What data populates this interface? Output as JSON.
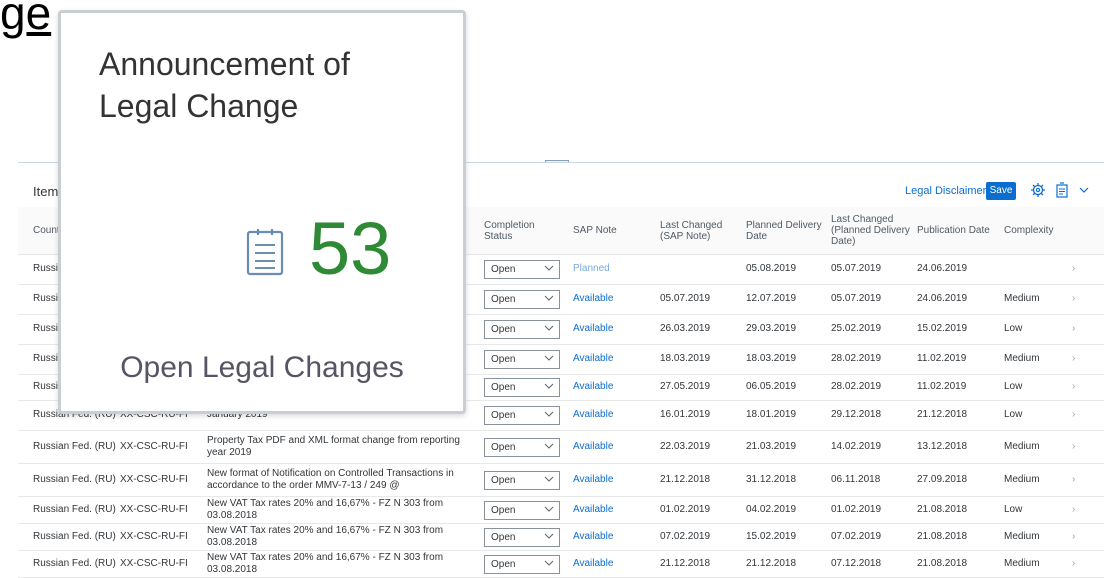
{
  "slide": {
    "heading_fragment": "ge"
  },
  "table": {
    "title": "Item",
    "disclaimer": "Legal Disclaimer",
    "save_label": "Save",
    "columns": {
      "country": "Count",
      "completion_status": "Completion Status",
      "sap_note": "SAP Note",
      "last_changed_sap": "Last Changed (SAP Note)",
      "planned_delivery": "Planned Delivery Date",
      "last_changed_planned": "Last Changed (Planned Delivery Date)",
      "publication_date": "Publication Date",
      "complexity": "Complexity"
    },
    "rows": [
      {
        "country": "Russi",
        "component": "",
        "description": "",
        "status": "Open",
        "sap_note": "Planned",
        "last_changed_sap": "",
        "planned_delivery": "05.08.2019",
        "last_changed_planned": "05.07.2019",
        "publication": "24.06.2019",
        "complexity": ""
      },
      {
        "country": "Russi",
        "component": "",
        "description": "",
        "status": "Open",
        "sap_note": "Available",
        "last_changed_sap": "05.07.2019",
        "planned_delivery": "12.07.2019",
        "last_changed_planned": "05.07.2019",
        "publication": "24.06.2019",
        "complexity": "Medium"
      },
      {
        "country": "Russi",
        "component": "",
        "description": "",
        "status": "Open",
        "sap_note": "Available",
        "last_changed_sap": "26.03.2019",
        "planned_delivery": "29.03.2019",
        "last_changed_planned": "25.02.2019",
        "publication": "15.02.2019",
        "complexity": "Low"
      },
      {
        "country": "Russi",
        "component": "",
        "description": "",
        "status": "Open",
        "sap_note": "Available",
        "last_changed_sap": "18.03.2019",
        "planned_delivery": "18.03.2019",
        "last_changed_planned": "28.02.2019",
        "publication": "11.02.2019",
        "complexity": "Medium"
      },
      {
        "country": "Russi",
        "component": "",
        "description": "",
        "status": "Open",
        "sap_note": "Available",
        "last_changed_sap": "27.05.2019",
        "planned_delivery": "06.05.2019",
        "last_changed_planned": "28.02.2019",
        "publication": "11.02.2019",
        "complexity": "Low"
      },
      {
        "country": "Russian Fed. (RU)",
        "component": "XX-CSC-RU-FI",
        "description": "January 2019",
        "status": "Open",
        "sap_note": "Available",
        "last_changed_sap": "16.01.2019",
        "planned_delivery": "18.01.2019",
        "last_changed_planned": "29.12.2018",
        "publication": "21.12.2018",
        "complexity": "Low"
      },
      {
        "country": "Russian Fed. (RU)",
        "component": "XX-CSC-RU-FI",
        "description": "Property Tax PDF and XML format change from reporting year 2019",
        "status": "Open",
        "sap_note": "Available",
        "last_changed_sap": "22.03.2019",
        "planned_delivery": "21.03.2019",
        "last_changed_planned": "14.02.2019",
        "publication": "13.12.2018",
        "complexity": "Medium"
      },
      {
        "country": "Russian Fed. (RU)",
        "component": "XX-CSC-RU-FI",
        "description": "New format of Notification on Controlled Transactions in accordance to the order MMV-7-13 / 249 @",
        "status": "Open",
        "sap_note": "Available",
        "last_changed_sap": "21.12.2018",
        "planned_delivery": "31.12.2018",
        "last_changed_planned": "06.11.2018",
        "publication": "27.09.2018",
        "complexity": "Medium"
      },
      {
        "country": "Russian Fed. (RU)",
        "component": "XX-CSC-RU-FI",
        "description": "New VAT Tax rates 20% and 16,67% - FZ N 303 from 03.08.2018",
        "status": "Open",
        "sap_note": "Available",
        "last_changed_sap": "01.02.2019",
        "planned_delivery": "04.02.2019",
        "last_changed_planned": "01.02.2019",
        "publication": "21.08.2018",
        "complexity": "Low"
      },
      {
        "country": "Russian Fed. (RU)",
        "component": "XX-CSC-RU-FI",
        "description": "New VAT Tax rates 20% and 16,67% - FZ N 303 from 03.08.2018",
        "status": "Open",
        "sap_note": "Available",
        "last_changed_sap": "07.02.2019",
        "planned_delivery": "15.02.2019",
        "last_changed_planned": "07.02.2019",
        "publication": "21.08.2018",
        "complexity": "Medium"
      },
      {
        "country": "Russian Fed. (RU)",
        "component": "XX-CSC-RU-FI",
        "description": "New VAT Tax rates 20% and 16,67% - FZ N 303 from 03.08.2018",
        "status": "Open",
        "sap_note": "Available",
        "last_changed_sap": "21.12.2018",
        "planned_delivery": "21.12.2018",
        "last_changed_planned": "07.12.2018",
        "publication": "21.08.2018",
        "complexity": "Medium"
      }
    ]
  },
  "tile": {
    "title": "Announcement of Legal Change",
    "count": "53",
    "subtitle": "Open Legal Changes",
    "count_color": "#2e8a34",
    "icon": "clipboard-list-icon"
  },
  "colors": {
    "accent": "#0a6ed1"
  }
}
